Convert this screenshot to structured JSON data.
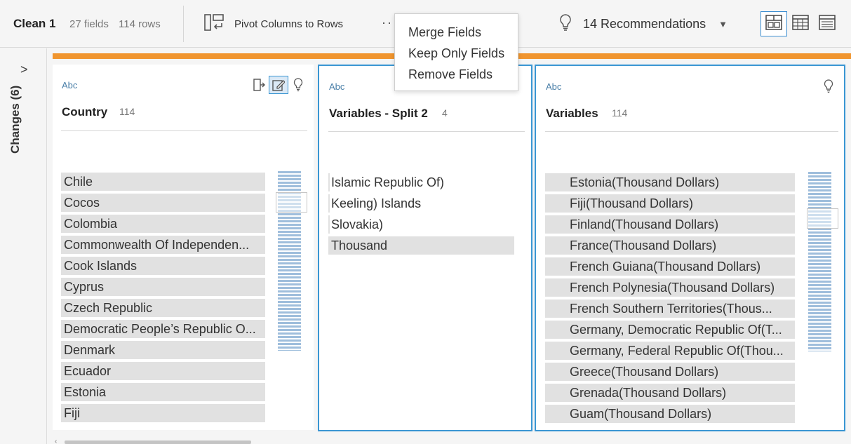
{
  "toolbar": {
    "title": "Clean 1",
    "fields_count": "27 fields",
    "rows_count": "114 rows",
    "pivot_label": "Pivot Columns to Rows",
    "more_dots": "··",
    "recommendations_label": "14 Recommendations",
    "icons": {
      "pivot": "pivot-columns-icon",
      "bulb": "lightbulb-icon",
      "caret": "caret-down-icon",
      "views": [
        "profile-view-icon",
        "data-grid-icon",
        "list-view-icon"
      ]
    }
  },
  "menu": {
    "items": [
      "Merge Fields",
      "Keep Only Fields",
      "Remove Fields"
    ]
  },
  "rail": {
    "chevron": ">",
    "label": "Changes (6)"
  },
  "colors": {
    "accent_orange": "#f0952f",
    "selection_blue": "#3a96d3",
    "histogram_blue": "#9fbedc",
    "type_label": "#4a7fa8"
  },
  "cards": [
    {
      "type_label": "Abc",
      "name": "Country",
      "count": "114",
      "icons": [
        "field-menu-icon",
        "edit-values-icon",
        "lightbulb-icon"
      ],
      "values": [
        "Chile",
        "Cocos",
        "Colombia",
        "Commonwealth Of Independen...",
        "Cook Islands",
        "Cyprus",
        "Czech Republic",
        "Democratic People’s Republic O...",
        "Denmark",
        "Ecuador",
        "Estonia",
        "Fiji"
      ]
    },
    {
      "type_label": "Abc",
      "name": "Variables - Split 2",
      "count": "4",
      "values": [
        "Islamic Republic Of)",
        "Keeling) Islands",
        "Slovakia)",
        "Thousand"
      ]
    },
    {
      "type_label": "Abc",
      "name": "Variables",
      "count": "114",
      "icons": [
        "lightbulb-icon"
      ],
      "values": [
        "Estonia(Thousand Dollars)",
        "Fiji(Thousand Dollars)",
        "Finland(Thousand Dollars)",
        "France(Thousand Dollars)",
        "French Guiana(Thousand Dollars)",
        "French Polynesia(Thousand Dollars)",
        "French Southern Territories(Thous...",
        "Germany, Democratic Republic Of(T...",
        "Germany, Federal Republic Of(Thou...",
        "Greece(Thousand Dollars)",
        "Grenada(Thousand Dollars)",
        "Guam(Thousand Dollars)"
      ]
    }
  ],
  "bottom_scroll": {
    "arrow": "‹"
  }
}
